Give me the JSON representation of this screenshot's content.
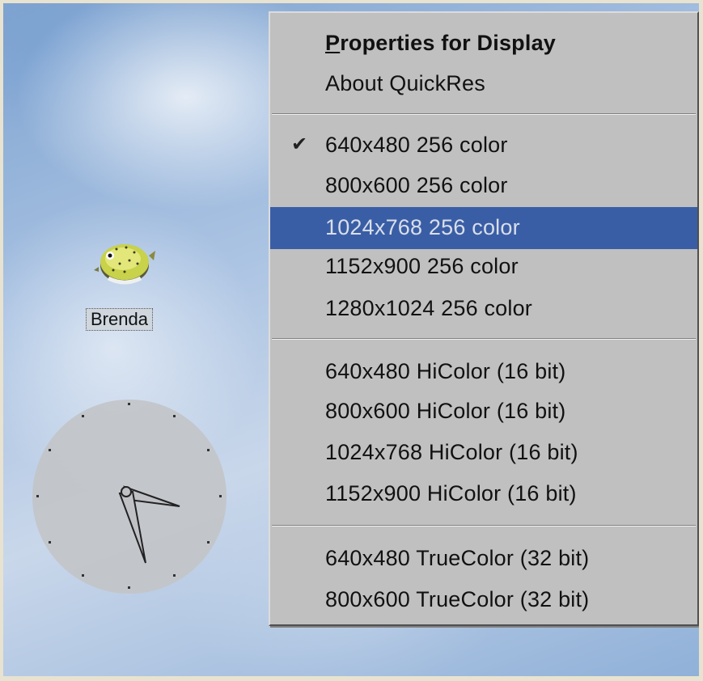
{
  "desktop": {
    "icon": {
      "label": "Brenda",
      "icon": "pufferfish-icon"
    },
    "clock": {
      "icon": "analog-clock-icon"
    }
  },
  "menu": {
    "header_items": [
      {
        "label_accel": "P",
        "label_rest": "roperties for Display",
        "bold": true
      },
      {
        "label": "About QuickRes"
      }
    ],
    "groups": [
      {
        "items": [
          {
            "label": "640x480 256 color",
            "checked": true
          },
          {
            "label": "800x600 256 color"
          },
          {
            "label": "1024x768 256 color",
            "selected": true
          },
          {
            "label": "1152x900 256 color"
          },
          {
            "label": "1280x1024 256 color"
          }
        ]
      },
      {
        "items": [
          {
            "label": "640x480 HiColor (16 bit)"
          },
          {
            "label": "800x600 HiColor (16 bit)"
          },
          {
            "label": "1024x768 HiColor (16 bit)"
          },
          {
            "label": "1152x900 HiColor (16 bit)"
          }
        ]
      },
      {
        "items": [
          {
            "label": "640x480 TrueColor (32 bit)"
          },
          {
            "label": "800x600 TrueColor (32 bit)"
          }
        ]
      }
    ],
    "check_glyph": "✔",
    "colors": {
      "menu_bg": "#c0c0c0",
      "highlight_bg": "#3a5ea6",
      "highlight_text": "#d9dfea"
    }
  }
}
